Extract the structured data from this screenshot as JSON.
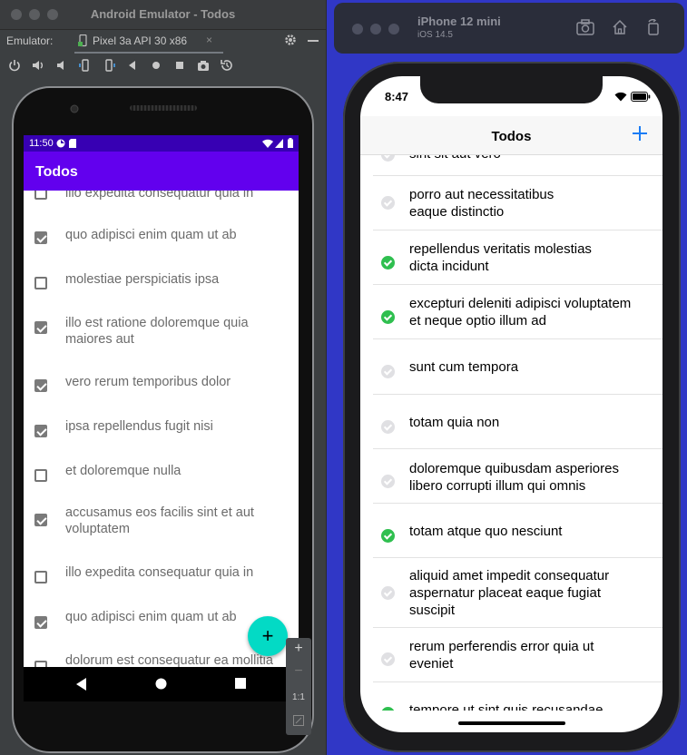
{
  "android_window": {
    "title": "Android Emulator - Todos",
    "emulator_label": "Emulator:",
    "device_tab": "Pixel 3a API 30 x86",
    "tab_close": "×",
    "zoom": {
      "plus": "+",
      "minus": "−",
      "ratio": "1:1"
    }
  },
  "android_app": {
    "status_time": "11:50",
    "title": "Todos",
    "fab_label": "+",
    "items": [
      {
        "text": "illo expedita consequatur quia in",
        "checked": false
      },
      {
        "text": "quo adipisci enim quam ut ab",
        "checked": true
      },
      {
        "text": "molestiae perspiciatis ipsa",
        "checked": false
      },
      {
        "text": "illo est ratione doloremque quia maiores aut",
        "checked": true
      },
      {
        "text": "vero rerum temporibus dolor",
        "checked": true
      },
      {
        "text": "ipsa repellendus fugit nisi",
        "checked": true
      },
      {
        "text": "et doloremque nulla",
        "checked": false
      },
      {
        "text": "accusamus eos facilis sint et aut voluptatem",
        "checked": true
      },
      {
        "text": "illo expedita consequatur quia in",
        "checked": false
      },
      {
        "text": "quo adipisci enim quam ut ab",
        "checked": true
      },
      {
        "text": "dolorum est consequatur ea mollitia",
        "checked": false
      }
    ]
  },
  "ios_window": {
    "device": "iPhone 12 mini",
    "os": "iOS 14.5"
  },
  "ios_app": {
    "status_time": "8:47",
    "title": "Todos",
    "items": [
      {
        "text": "sint sit aut vero",
        "done": false
      },
      {
        "text": "porro aut necessitatibus eaque distinctio",
        "done": false
      },
      {
        "text": "repellendus veritatis molestias dicta incidunt",
        "done": true
      },
      {
        "text": "excepturi deleniti adipisci voluptatem et neque optio illum ad",
        "done": true
      },
      {
        "text": "sunt cum tempora",
        "done": false
      },
      {
        "text": "totam quia non",
        "done": false
      },
      {
        "text": "doloremque quibusdam asperiores libero corrupti illum qui omnis",
        "done": false
      },
      {
        "text": "totam atque quo nesciunt",
        "done": true
      },
      {
        "text": "aliquid amet impedit consequatur aspernatur placeat eaque fugiat suscipit",
        "done": false
      },
      {
        "text": "rerum perferendis error quia ut eveniet",
        "done": false
      },
      {
        "text": "tempore ut sint quis recusandae",
        "done": true
      }
    ]
  },
  "colors": {
    "android_primary": "#6200ee",
    "android_status": "#3700b3",
    "android_fab": "#03dac5",
    "ios_tint": "#1a7cf5",
    "ios_done": "#2fbf4f",
    "background": "#3037c6"
  },
  "icons": {
    "emulator_toolbar": [
      "power-icon",
      "volume-up-icon",
      "volume-down-icon",
      "rotate-left-icon",
      "rotate-right-icon",
      "back-icon",
      "home-icon",
      "overview-icon",
      "camera-icon",
      "snapshot-icon"
    ],
    "ios_toolbar": [
      "screenshot-icon",
      "home-icon",
      "rotate-icon"
    ]
  }
}
